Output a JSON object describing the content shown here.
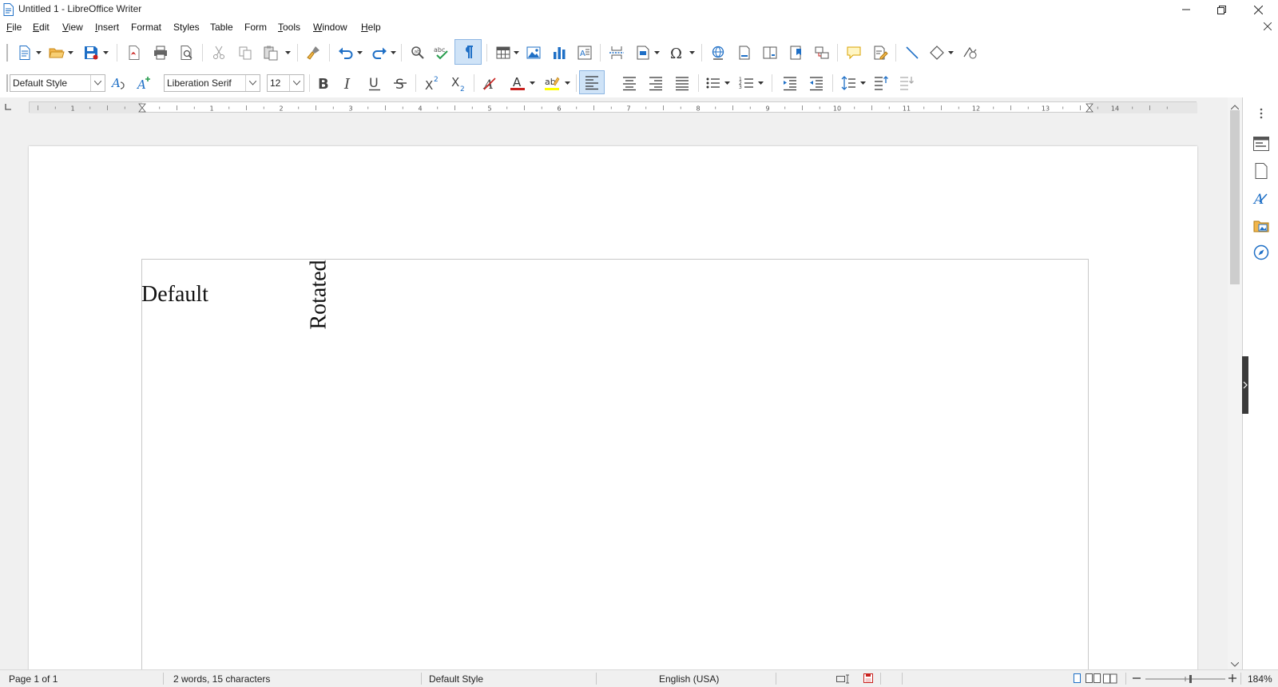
{
  "window": {
    "title": "Untitled 1 - LibreOffice Writer"
  },
  "menu": {
    "items": [
      {
        "label": "File",
        "key": "F",
        "rest": "ile"
      },
      {
        "label": "Edit",
        "key": "E",
        "rest": "dit"
      },
      {
        "label": "View",
        "key": "V",
        "rest": "iew"
      },
      {
        "label": "Insert",
        "key": "I",
        "rest": "nsert"
      },
      {
        "label": "Format",
        "key": "",
        "rest": "Format"
      },
      {
        "label": "Styles",
        "key": "",
        "rest": "Styles"
      },
      {
        "label": "Table",
        "key": "",
        "rest": "Table"
      },
      {
        "label": "Form",
        "key": "",
        "rest": "Form"
      },
      {
        "label": "Tools",
        "key": "T",
        "rest": "ools"
      },
      {
        "label": "Window",
        "key": "W",
        "rest": "indow"
      },
      {
        "label": "Help",
        "key": "H",
        "rest": "elp"
      }
    ]
  },
  "formatting": {
    "paragraph_style": "Default Style",
    "font_name": "Liberation Serif",
    "font_size": "12"
  },
  "document": {
    "text_default": "Default",
    "text_rotated": "Rotated"
  },
  "status": {
    "page": "Page 1 of 1",
    "words": "2 words, 15 characters",
    "page_style": "Default Style",
    "language": "English (USA)",
    "zoom": "184%"
  },
  "colors": {
    "accent": "#1e6fc6",
    "font_color": "#c9211e",
    "highlight_color": "#ffff00",
    "active_toggle_bg": "#cfe3f7"
  }
}
